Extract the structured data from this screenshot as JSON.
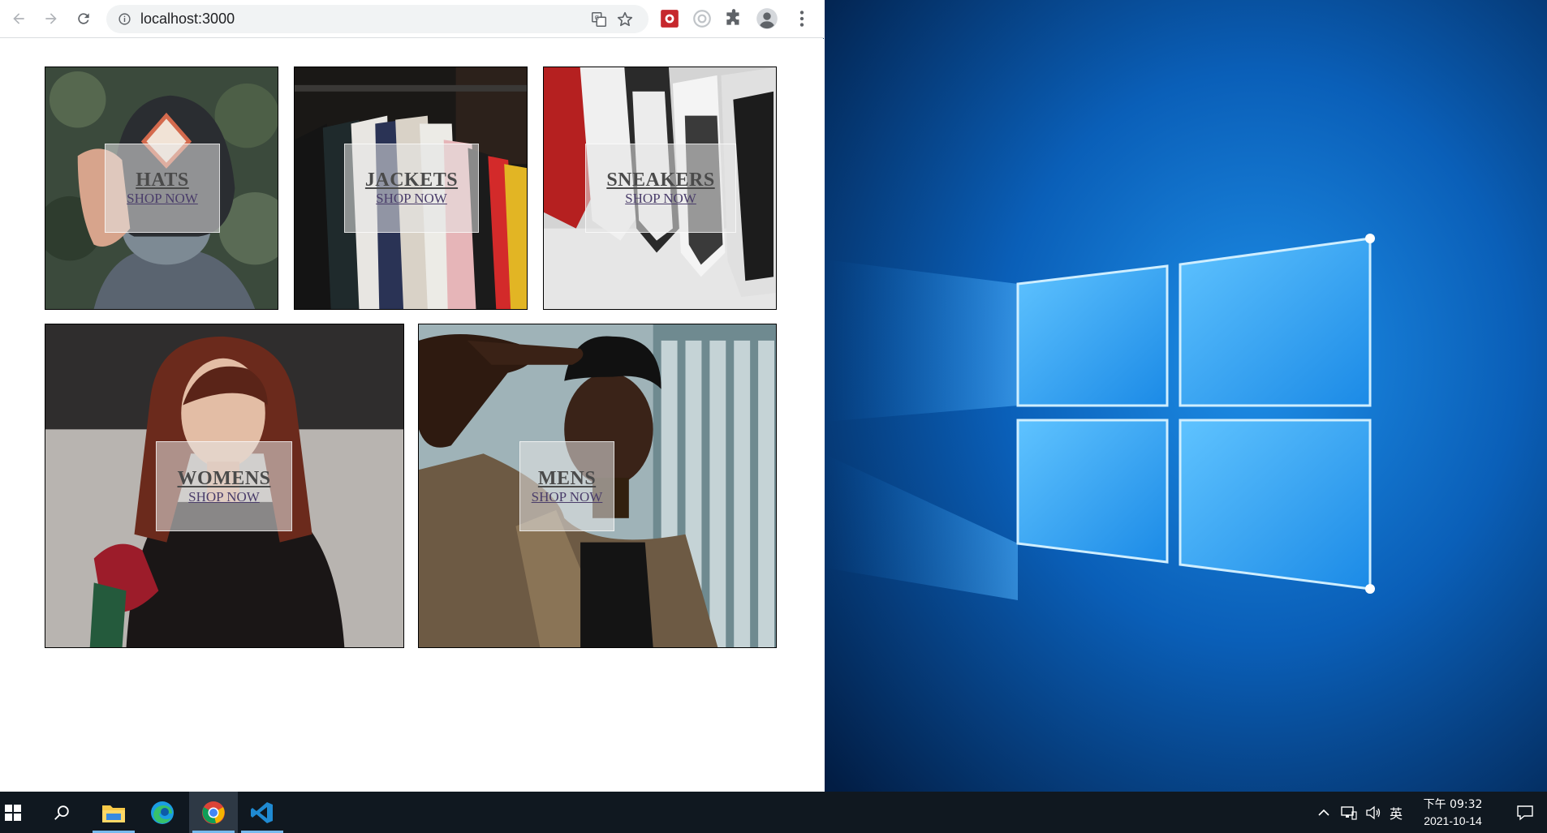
{
  "browser": {
    "url": "localhost:3000"
  },
  "categories": [
    {
      "title": "HATS",
      "cta": "SHOP NOW"
    },
    {
      "title": "JACKETS",
      "cta": "SHOP NOW"
    },
    {
      "title": "SNEAKERS",
      "cta": "SHOP NOW"
    },
    {
      "title": "WOMENS",
      "cta": "SHOP NOW"
    },
    {
      "title": "MENS",
      "cta": "SHOP NOW"
    }
  ],
  "taskbar": {
    "apps": [
      "start",
      "search",
      "file-explorer",
      "edge",
      "chrome",
      "vscode"
    ],
    "ime": "英",
    "time": "下午 09:32",
    "date": "2021-10-14"
  },
  "colors": {
    "taskbar": "#101820",
    "desktop_blue": "#0a5fb8",
    "active_indicator": "#76b9ed"
  }
}
